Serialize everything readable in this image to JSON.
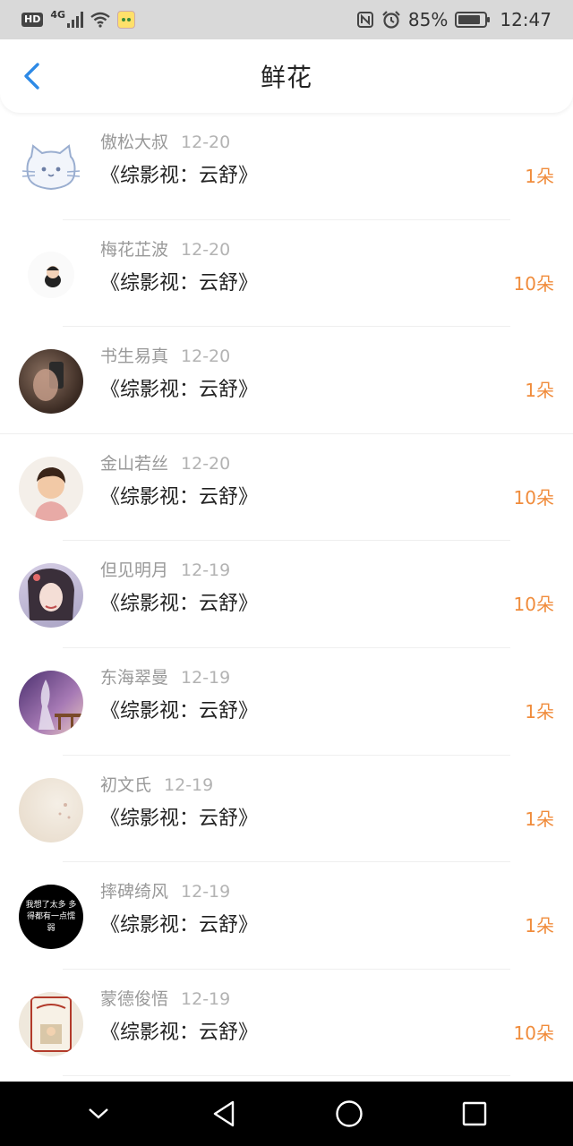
{
  "status_bar": {
    "hd": "HD",
    "network": "4G",
    "battery": "85%",
    "time": "12:47",
    "icons": [
      "hd-icon",
      "signal-icon",
      "wifi-icon",
      "app-notification-icon",
      "nfc-icon",
      "alarm-icon",
      "battery-icon"
    ]
  },
  "header": {
    "title": "鲜花",
    "back_icon": "chevron-left-icon",
    "accent": "#2e8ae6"
  },
  "colors": {
    "amount": "#f08c3c",
    "meta": "#999999",
    "nav_bar": "#000000"
  },
  "list": {
    "items": [
      {
        "name": "傲松大叔",
        "date": "12-20",
        "work": "《综影视：云舒》",
        "amount": "1朵"
      },
      {
        "name": "梅花芷波",
        "date": "12-20",
        "work": "《综影视：云舒》",
        "amount": "10朵"
      },
      {
        "name": "书生易真",
        "date": "12-20",
        "work": "《综影视：云舒》",
        "amount": "1朵"
      },
      {
        "name": "金山若丝",
        "date": "12-20",
        "work": "《综影视：云舒》",
        "amount": "10朵"
      },
      {
        "name": "但见明月",
        "date": "12-19",
        "work": "《综影视：云舒》",
        "amount": "10朵"
      },
      {
        "name": "东海翠曼",
        "date": "12-19",
        "work": "《综影视：云舒》",
        "amount": "1朵"
      },
      {
        "name": "初文氏",
        "date": "12-19",
        "work": "《综影视：云舒》",
        "amount": "1朵"
      },
      {
        "name": "摔碑绮风",
        "date": "12-19",
        "work": "《综影视：云舒》",
        "amount": "1朵"
      },
      {
        "name": "蒙德俊悟",
        "date": "12-19",
        "work": "《综影视：云舒》",
        "amount": "10朵"
      }
    ]
  },
  "avatar_texts": {
    "row8": "我想了太多 多得都有一点懦弱"
  },
  "nav_bar": {
    "icons": [
      "chevron-down-icon",
      "back-triangle-icon",
      "home-circle-icon",
      "recents-square-icon"
    ]
  }
}
